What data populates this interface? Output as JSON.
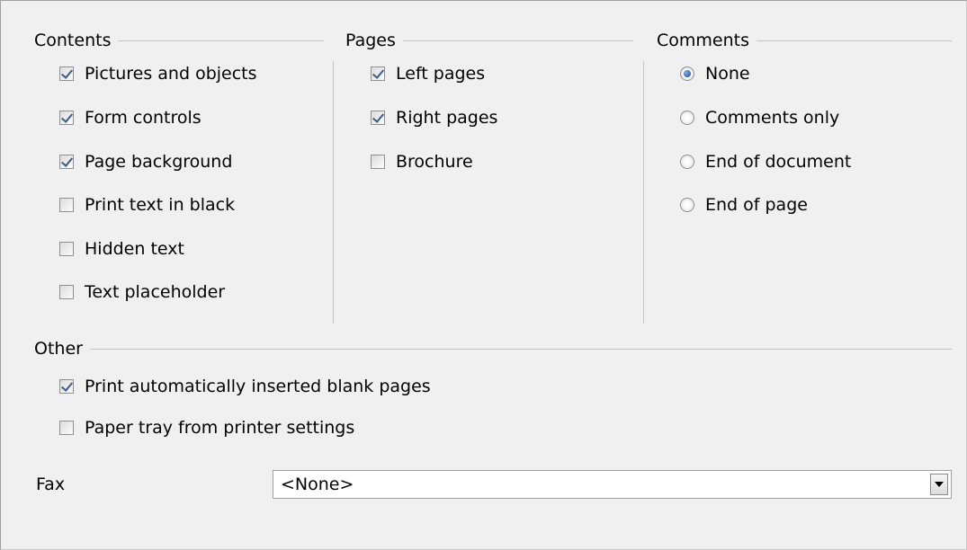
{
  "contents": {
    "title": "Contents",
    "items": [
      {
        "label": "Pictures and objects",
        "checked": true
      },
      {
        "label": "Form controls",
        "checked": true
      },
      {
        "label": "Page background",
        "checked": true
      },
      {
        "label": "Print text in black",
        "checked": false
      },
      {
        "label": "Hidden text",
        "checked": false
      },
      {
        "label": "Text placeholder",
        "checked": false
      }
    ]
  },
  "pages": {
    "title": "Pages",
    "items": [
      {
        "label": "Left pages",
        "checked": true
      },
      {
        "label": "Right pages",
        "checked": true
      },
      {
        "label": "Brochure",
        "checked": false
      }
    ]
  },
  "comments": {
    "title": "Comments",
    "items": [
      {
        "label": "None",
        "selected": true
      },
      {
        "label": "Comments only",
        "selected": false
      },
      {
        "label": "End of document",
        "selected": false
      },
      {
        "label": "End of page",
        "selected": false
      }
    ]
  },
  "other": {
    "title": "Other",
    "items": [
      {
        "label": "Print automatically inserted blank pages",
        "checked": true
      },
      {
        "label": "Paper tray from printer settings",
        "checked": false
      }
    ],
    "fax_label": "Fax",
    "fax_value": "<None>"
  },
  "colors": {
    "checkmark": "#3c5a8a",
    "radio_dot": "#1e4fa0",
    "background": "#f0f0f0"
  }
}
